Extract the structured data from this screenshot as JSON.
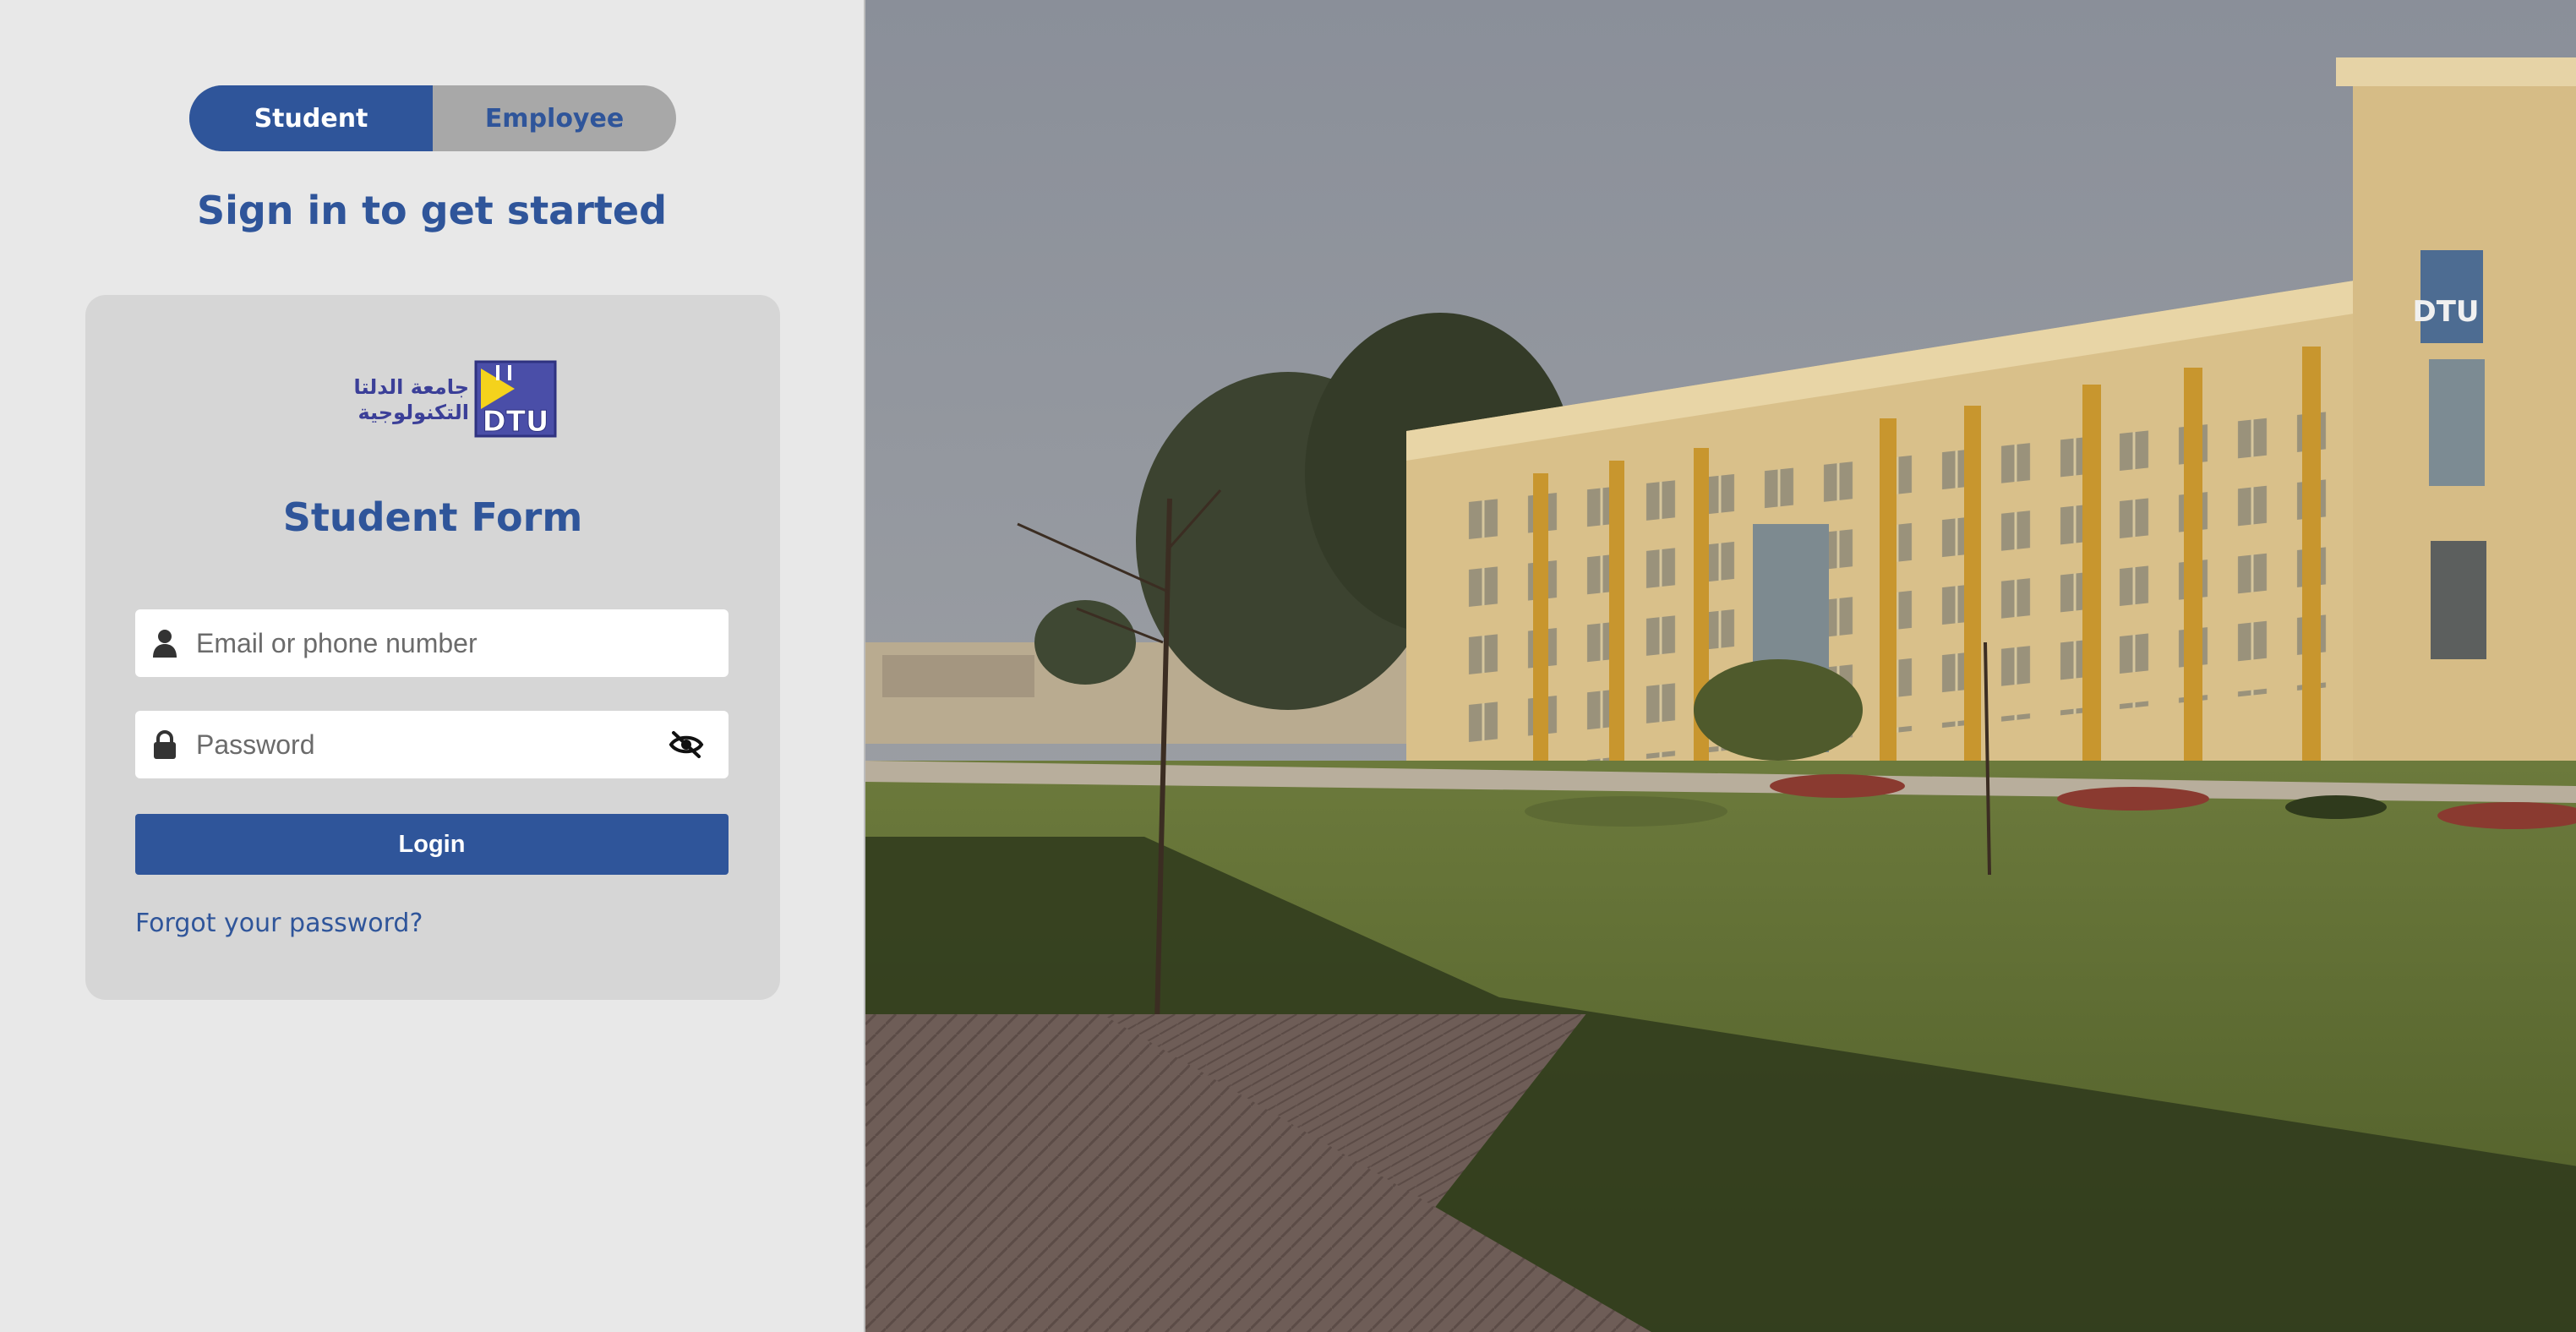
{
  "role_switch": {
    "student_label": "Student",
    "employee_label": "Employee",
    "selected": "Student"
  },
  "header": {
    "title": "Sign in to get started"
  },
  "form": {
    "logo": {
      "arabic_line1": "جامعة الدلتا",
      "arabic_line2": "التكنولوجية",
      "abbr": "DTU"
    },
    "title": "Student Form",
    "email_placeholder": "Email or phone number",
    "email_value": "",
    "password_placeholder": "Password",
    "password_value": "",
    "login_label": "Login",
    "forgot_label": "Forgot your password?",
    "icons": {
      "email": "user-icon",
      "password": "lock-icon",
      "visibility": "eye-slash-icon"
    }
  },
  "hero_image": {
    "building_sign": "DTU"
  },
  "colors": {
    "primary": "#2f559a",
    "panel_bg": "#e8e8e8",
    "card_bg": "#d6d6d6",
    "toggle_inactive": "#a8a8a8"
  }
}
